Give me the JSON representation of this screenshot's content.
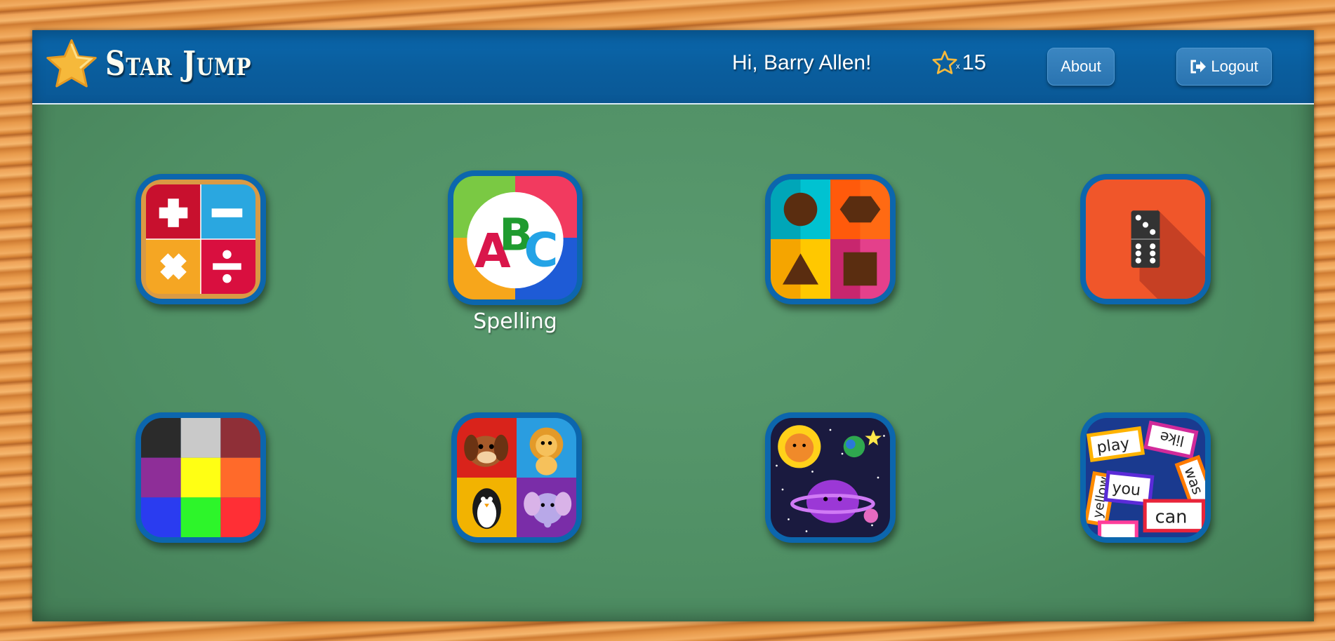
{
  "header": {
    "app_title": "Star Jump",
    "greeting": "Hi, Barry Allen!",
    "star_count_multiplier": "x",
    "star_count": "15",
    "about_label": "About",
    "logout_label": "Logout"
  },
  "games": [
    {
      "icon": "math-operations-icon",
      "label": ""
    },
    {
      "icon": "abc-spelling-icon",
      "label": "Spelling"
    },
    {
      "icon": "shapes-icon",
      "label": ""
    },
    {
      "icon": "domino-icon",
      "label": ""
    },
    {
      "icon": "color-grid-icon",
      "label": ""
    },
    {
      "icon": "animals-icon",
      "label": ""
    },
    {
      "icon": "space-planets-icon",
      "label": ""
    },
    {
      "icon": "sight-words-icon",
      "label": ""
    }
  ],
  "sight_words": [
    "play",
    "like",
    "was",
    "yellow",
    "you",
    "can"
  ],
  "colors": {
    "header_blue": "#0a5e9e",
    "chalkboard_green": "#4f8f64",
    "wood": "#e89a4b",
    "star_gold": "#f6b93b"
  }
}
